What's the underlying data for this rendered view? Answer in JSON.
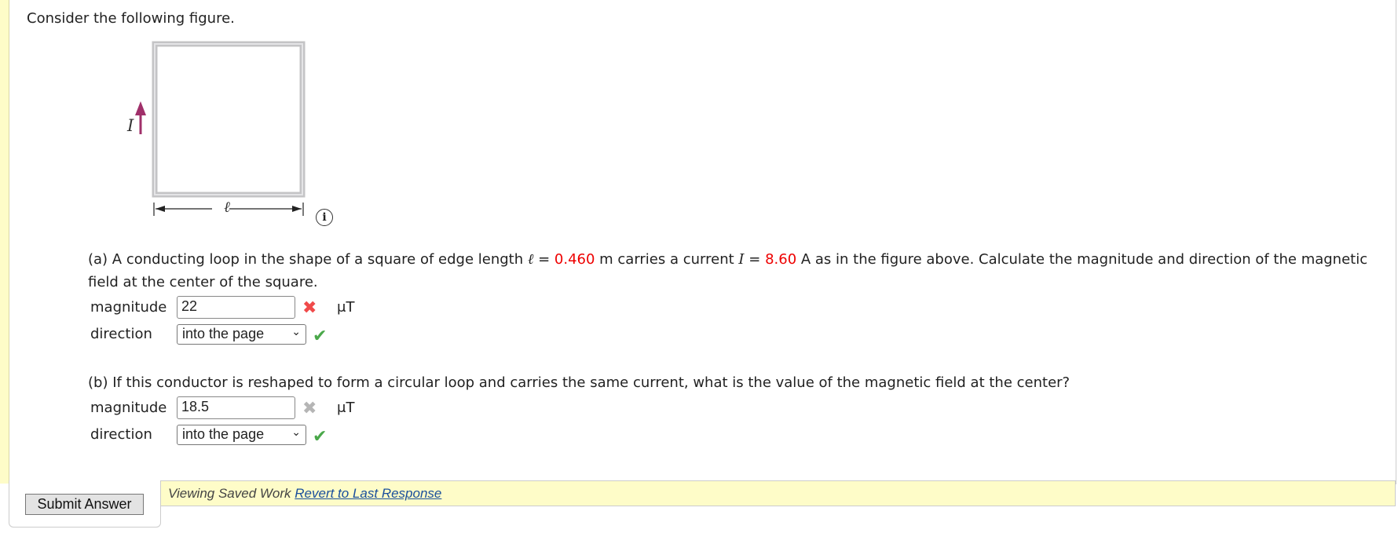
{
  "intro": "Consider the following figure.",
  "figure": {
    "current_label": "I",
    "length_label": "ℓ",
    "info_icon": "info-circle-icon",
    "arrow_color": "#a0306a"
  },
  "part_a": {
    "text_1": "(a) A conducting loop in the shape of a square of edge length ",
    "ell": "ℓ",
    "eq1": " = ",
    "length_value": "0.460",
    "text_2": " m carries a current ",
    "I": "I",
    "eq2": " = ",
    "current_value": "8.60",
    "text_3": " A as in the figure above. Calculate the magnitude and direction of the magnetic field at the center of the square.",
    "magnitude_label": "magnitude",
    "magnitude_value": "22",
    "magnitude_status": "incorrect",
    "unit": "μT",
    "direction_label": "direction",
    "direction_value": "into the page",
    "direction_status": "correct"
  },
  "part_b": {
    "text": "(b) If this conductor is reshaped to form a circular loop and carries the same current, what is the value of the magnetic field at the center?",
    "magnitude_label": "magnitude",
    "magnitude_value": "18.5",
    "magnitude_status": "incorrect (greyed)",
    "unit": "μT",
    "direction_label": "direction",
    "direction_value": "into the page",
    "direction_status": "correct"
  },
  "footer": {
    "submit_label": "Submit Answer",
    "saved_text": "Viewing Saved Work ",
    "revert_link": "Revert to Last Response"
  }
}
